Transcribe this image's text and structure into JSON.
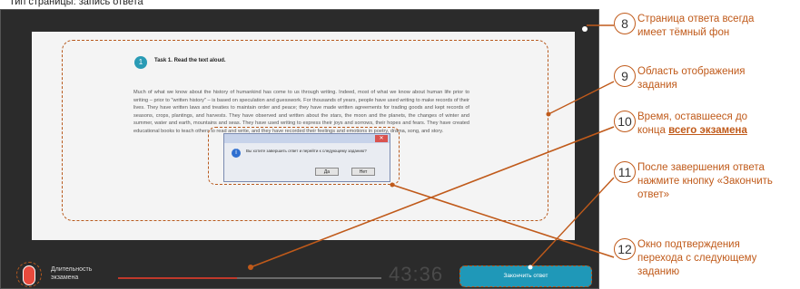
{
  "page": {
    "caption": "Тип страницы: запись ответа"
  },
  "task": {
    "number": "1",
    "heading": "Task 1. Read the text aloud.",
    "body": "Much of what we know about the history of humankind has come to us through writing. Indeed, most of what we know about human life prior to writing – prior to \"written history\" – is based on speculation and guesswork. For thousands of years, people have used writing to make records of their lives. They have written laws and treaties to maintain order and peace; they have made written agreements for trading goods and kept records of seasons, crops, plantings, and harvests. They have observed and written about the stars, the moon and the planets, the changes of winter and summer, water and earth, mountains and seas. They have used writing to express their joys and sorrows, their hopes and fears. They have created educational books to teach others to read and write, and they have recorded their feelings and emotions in poetry, drama, song, and story."
  },
  "dialog": {
    "title": "",
    "message": "Вы хотите завершить ответ и перейти к следующему заданию?",
    "yes_label": "Да",
    "no_label": "Нет"
  },
  "footer": {
    "duration_label": "Длительность экзамена",
    "timer": "43:36",
    "finish_label": "Закончить ответ",
    "progress": 0.45
  },
  "callouts": [
    {
      "num": "8",
      "text": "Страница ответа всегда имеет тёмный фон"
    },
    {
      "num": "9",
      "text": "Область отображения задания"
    },
    {
      "num": "10",
      "text_a": "Время, оставшееся до конца ",
      "text_u": "всего экзамена"
    },
    {
      "num": "11",
      "text": "После завершения ответа нажмите кнопку «Закончить ответ»"
    },
    {
      "num": "12",
      "text": "Окно подтверждения перехода с следующему заданию"
    }
  ],
  "colors": {
    "accent": "#c05a1a",
    "screen_bg": "#2b2b2b",
    "button": "#1f98b8"
  }
}
